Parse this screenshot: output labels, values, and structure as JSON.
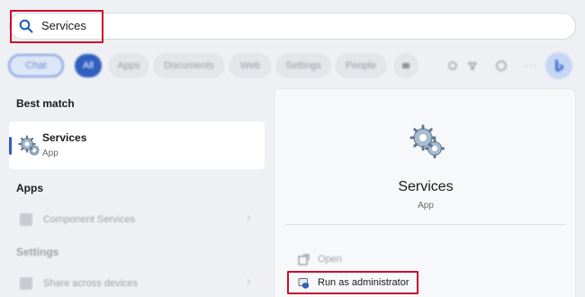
{
  "search": {
    "value": "Services"
  },
  "filters": {
    "chat": "Chat",
    "all": "All",
    "apps": "Apps",
    "documents": "Documents",
    "web": "Web",
    "settings": "Settings",
    "people": "People",
    "more": "···"
  },
  "best_match": {
    "section_label": "Best match",
    "title": "Services",
    "subtitle": "App"
  },
  "apps_section": {
    "section_label": "Apps",
    "items": [
      {
        "label": "Component Services",
        "chevron": "›"
      }
    ]
  },
  "settings_section": {
    "section_label": "Settings",
    "items": [
      {
        "label": "Share across devices",
        "chevron": "›"
      }
    ]
  },
  "detail": {
    "title": "Services",
    "subtitle": "App",
    "actions": [
      {
        "label": "Open"
      },
      {
        "label": "Run as administrator"
      }
    ]
  },
  "colors": {
    "highlight_red": "#c8102e",
    "accent_blue": "#2f5fbf"
  }
}
